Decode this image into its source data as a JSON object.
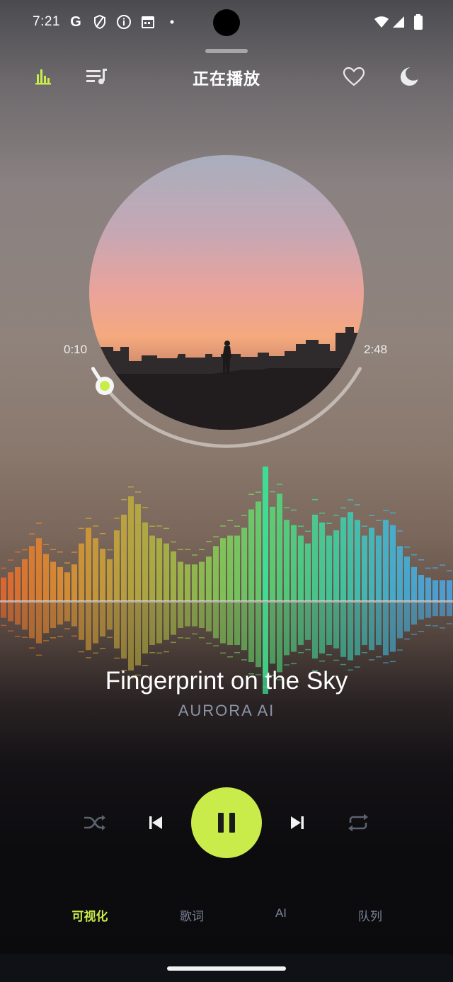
{
  "status_bar": {
    "time": "7:21",
    "google_letter": "G",
    "dot": "•",
    "icons": [
      "google-icon",
      "shield-icon",
      "info-icon",
      "calendar-icon",
      "notification-dot-icon",
      "wifi-icon",
      "signal-icon",
      "battery-icon"
    ]
  },
  "header": {
    "title": "正在播放",
    "left_icons": [
      "equalizer-icon",
      "playlist-icon"
    ],
    "right_icons": [
      "heart-icon",
      "moon-icon"
    ]
  },
  "player": {
    "elapsed": "0:10",
    "duration": "2:48",
    "progress": 0.06,
    "song_title": "Fingerprint on the Sky",
    "artist": "AURORA AI",
    "state": "playing"
  },
  "visualizer": {
    "bars": [
      0.18,
      0.22,
      0.26,
      0.32,
      0.42,
      0.48,
      0.36,
      0.3,
      0.26,
      0.22,
      0.28,
      0.44,
      0.56,
      0.48,
      0.4,
      0.32,
      0.54,
      0.66,
      0.8,
      0.74,
      0.6,
      0.5,
      0.48,
      0.44,
      0.38,
      0.3,
      0.28,
      0.28,
      0.3,
      0.34,
      0.42,
      0.48,
      0.5,
      0.5,
      0.56,
      0.7,
      0.76,
      0.88,
      0.72,
      0.82,
      0.62,
      0.58,
      0.5,
      0.44,
      0.66,
      0.6,
      0.5,
      0.54,
      0.64,
      0.68,
      0.62,
      0.5,
      0.56,
      0.5,
      0.62,
      0.58,
      0.42,
      0.34,
      0.26,
      0.2,
      0.18,
      0.16,
      0.16,
      0.16
    ],
    "peak_bar_index": 37,
    "colors": [
      "#ee6a2a",
      "#e7932e",
      "#c9a83a",
      "#a9bd44",
      "#80d35a",
      "#4fdc80",
      "#3ad6a8",
      "#40b8e0",
      "#4aa8ea"
    ]
  },
  "controls": {
    "buttons": [
      "shuffle-icon",
      "previous-icon",
      "pause-icon",
      "next-icon",
      "repeat-icon"
    ]
  },
  "tabs": [
    {
      "label": "可视化",
      "active": true
    },
    {
      "label": "歌词",
      "active": false
    },
    {
      "label": "AI",
      "active": false
    },
    {
      "label": "队列",
      "active": false
    }
  ],
  "colors": {
    "accent": "#c9ec4b",
    "inactive_tab": "#7a8396",
    "artist_text": "#8c93a6"
  }
}
